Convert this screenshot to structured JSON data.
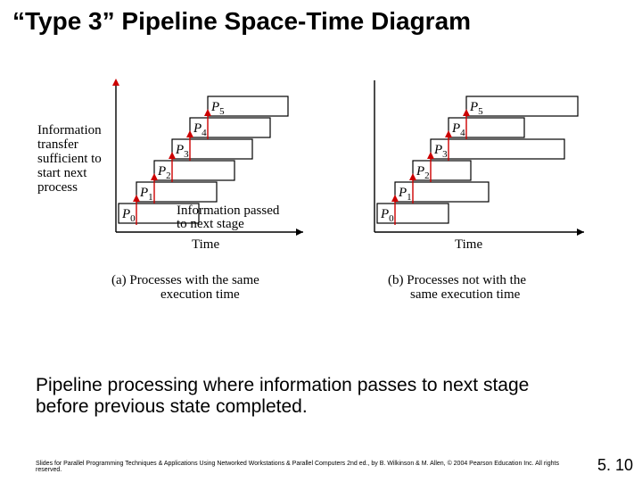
{
  "title": "“Type 3” Pipeline Space-Time Diagram",
  "annotation_left": {
    "l1": "Information",
    "l2": "transfer",
    "l3": "sufficient to",
    "l4": "start next",
    "l5": "process"
  },
  "annotation_mid": "Information passed",
  "annotation_mid2": "to next stage",
  "axis_time_a": "Time",
  "axis_time_b": "Time",
  "caption_a": "(a) Processes with the same",
  "caption_a2": "execution time",
  "caption_b": "(b) Processes not with the",
  "caption_b2": "same execution time",
  "processes": [
    "P",
    "P",
    "P",
    "P",
    "P",
    "P"
  ],
  "subs": [
    "0",
    "1",
    "2",
    "3",
    "4",
    "5"
  ],
  "body": "Pipeline processing where information passes to next stage before previous state completed.",
  "footer": "Slides for Parallel Programming Techniques & Applications Using Networked Workstations & Parallel Computers 2nd ed., by B. Wilkinson & M. Allen, © 2004 Pearson Education Inc. All rights reserved.",
  "pagenum": "5. 10",
  "chart_data": {
    "type": "diagram",
    "panels": [
      {
        "id": "a",
        "caption": "(a) Processes with the same execution time",
        "x_axis": "Time",
        "processes": [
          {
            "name": "P0",
            "start": 0,
            "duration": 5,
            "transfer_at": 1
          },
          {
            "name": "P1",
            "start": 1,
            "duration": 5,
            "transfer_at": 2
          },
          {
            "name": "P2",
            "start": 2,
            "duration": 5,
            "transfer_at": 3
          },
          {
            "name": "P3",
            "start": 3,
            "duration": 5,
            "transfer_at": 4
          },
          {
            "name": "P4",
            "start": 4,
            "duration": 5,
            "transfer_at": 5
          },
          {
            "name": "P5",
            "start": 5,
            "duration": 5
          }
        ]
      },
      {
        "id": "b",
        "caption": "(b) Processes not with the same execution time",
        "x_axis": "Time",
        "processes": [
          {
            "name": "P0",
            "start": 0,
            "duration": 5,
            "transfer_at": 1
          },
          {
            "name": "P1",
            "start": 1,
            "duration": 6,
            "transfer_at": 2
          },
          {
            "name": "P2",
            "start": 2,
            "duration": 4,
            "transfer_at": 3
          },
          {
            "name": "P3",
            "start": 3,
            "duration": 8,
            "transfer_at": 4
          },
          {
            "name": "P4",
            "start": 4,
            "duration": 5,
            "transfer_at": 5
          },
          {
            "name": "P5",
            "start": 5,
            "duration": 7
          }
        ]
      }
    ]
  }
}
